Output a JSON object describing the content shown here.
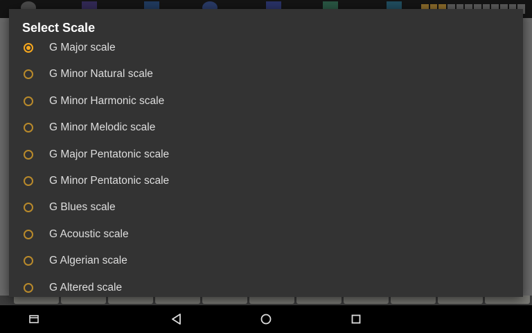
{
  "dialog": {
    "title": "Select Scale",
    "options": [
      {
        "label": "G Major scale",
        "selected": true
      },
      {
        "label": "G Minor Natural scale",
        "selected": false
      },
      {
        "label": "G Minor Harmonic scale",
        "selected": false
      },
      {
        "label": "G Minor Melodic scale",
        "selected": false
      },
      {
        "label": "G Major Pentatonic scale",
        "selected": false
      },
      {
        "label": "G Minor Pentatonic scale",
        "selected": false
      },
      {
        "label": "G Blues scale",
        "selected": false
      },
      {
        "label": "G Acoustic scale",
        "selected": false
      },
      {
        "label": "G Algerian scale",
        "selected": false
      },
      {
        "label": "G Altered scale",
        "selected": false
      }
    ]
  },
  "navbar": {
    "icons": [
      "recents-icon",
      "back-icon",
      "home-icon",
      "overview-icon"
    ]
  },
  "colors": {
    "accent": "#f7a81e",
    "dialog_background": "#333333",
    "navbar_background": "#000000"
  }
}
